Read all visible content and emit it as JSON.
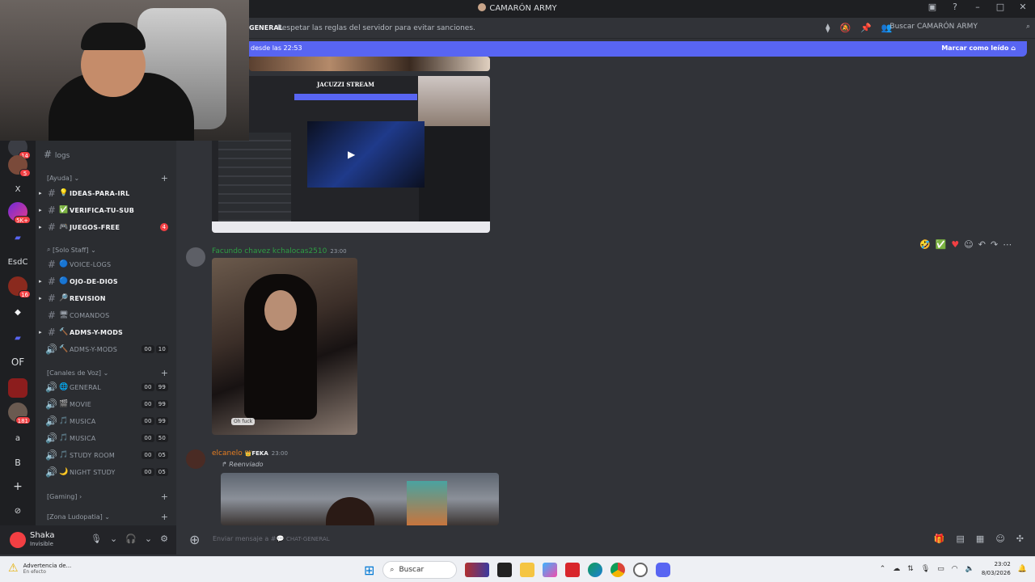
{
  "window": {
    "title": "CAMARÓN ARMY"
  },
  "header": {
    "channel_name": "CHAT-GENERAL",
    "channel_name_visible": "CHAT-GENERAL",
    "topic": "Respetar las reglas del servidor para evitar sanciones.",
    "search_placeholder": "Buscar CAMARÓN ARMY"
  },
  "new_messages": {
    "since": "desde las 22:53",
    "mark_read": "Marcar como leído"
  },
  "rail": {
    "items": [
      {
        "label": "",
        "badge": "14"
      },
      {
        "label": "",
        "badge": "5"
      },
      {
        "label": "X",
        "badge": ""
      },
      {
        "label": "",
        "badge": "5K+"
      },
      {
        "label": "",
        "badge": ""
      },
      {
        "label": "EsdC",
        "badge": ""
      },
      {
        "label": "",
        "badge": "16"
      },
      {
        "label": "",
        "badge": ""
      },
      {
        "label": "",
        "badge": ""
      },
      {
        "label": "OF",
        "badge": ""
      },
      {
        "label": "",
        "badge": ""
      },
      {
        "label": "",
        "badge": "181"
      },
      {
        "label": "a",
        "badge": ""
      },
      {
        "label": "B",
        "badge": ""
      },
      {
        "label": "+",
        "badge": ""
      },
      {
        "label": "",
        "badge": ""
      }
    ]
  },
  "sidebar": {
    "logs": "logs",
    "categories": {
      "ayuda": "[Ayuda]",
      "solo_staff": "[Solo Staff]",
      "canales_voz": "[Canales de Voz]",
      "gaming": "[Gaming]",
      "zona": "[Zona Ludopatia]"
    },
    "channels": [
      {
        "name": "IDEAS-PARA-IRL",
        "emoji": "💡",
        "unread": true,
        "mention": "",
        "c1": "",
        "c2": ""
      },
      {
        "name": "VERIFICA-TU-SUB",
        "emoji": "✅",
        "unread": true,
        "mention": "",
        "c1": "",
        "c2": ""
      },
      {
        "name": "JUEGOS-FREE",
        "emoji": "🎮",
        "unread": true,
        "mention": "4",
        "c1": "",
        "c2": ""
      },
      {
        "name": "VOICE-LOGS",
        "emoji": "🔵",
        "unread": false,
        "mention": "",
        "c1": "",
        "c2": ""
      },
      {
        "name": "OJO-DE-DIOS",
        "emoji": "🔵",
        "unread": true,
        "mention": "",
        "c1": "",
        "c2": ""
      },
      {
        "name": "REVISION",
        "emoji": "🔎",
        "unread": true,
        "mention": "",
        "c1": "",
        "c2": ""
      },
      {
        "name": "COMANDOS",
        "emoji": "🖥",
        "unread": false,
        "mention": "",
        "c1": "",
        "c2": ""
      },
      {
        "name": "ADMS-Y-MODS",
        "emoji": "🔨",
        "unread": true,
        "mention": "",
        "c1": "",
        "c2": ""
      },
      {
        "name": "ADMS-Y-MODS",
        "emoji": "🔨",
        "unread": false,
        "mention": "",
        "c1": "00",
        "c2": "10"
      },
      {
        "name": "GENERAL",
        "emoji": "🌐",
        "unread": false,
        "mention": "",
        "c1": "00",
        "c2": "99"
      },
      {
        "name": "MOVIE",
        "emoji": "🎬",
        "unread": false,
        "mention": "",
        "c1": "00",
        "c2": "99"
      },
      {
        "name": "MUSICA",
        "emoji": "🎵",
        "unread": false,
        "mention": "",
        "c1": "00",
        "c2": "99"
      },
      {
        "name": "MUSICA",
        "emoji": "🎵",
        "unread": false,
        "mention": "",
        "c1": "00",
        "c2": "50"
      },
      {
        "name": "STUDY ROOM",
        "emoji": "🎵",
        "unread": false,
        "mention": "",
        "c1": "00",
        "c2": "05"
      },
      {
        "name": "NIGHT STUDY",
        "emoji": "🌙",
        "unread": false,
        "mention": "",
        "c1": "00",
        "c2": "05"
      }
    ]
  },
  "messages": [
    {
      "author": "Facundo chavez kchalocas2510",
      "time": "23:00",
      "color": "#2f9e44",
      "caption": "Oh fuck"
    },
    {
      "author": "elcanelo",
      "tag": "FEKA",
      "time": "23:00",
      "color": "#e67e22",
      "forwarded": "Reenviado"
    }
  ],
  "screenshot_embed": {
    "title": "JACUZZI STREAM"
  },
  "composer": {
    "placeholder": "Enviar mensaje a #",
    "channel": "CHAT-GENERAL"
  },
  "user": {
    "name": "Shaka",
    "status": "Invisible"
  },
  "taskbar": {
    "warning_title": "Advertencia de...",
    "warning_sub": "En efecto",
    "search": "Buscar",
    "time": "23:02",
    "date": "8/03/2026"
  },
  "colors": {
    "accent": "#5865f2",
    "danger": "#f23f43",
    "background": "#313338"
  }
}
